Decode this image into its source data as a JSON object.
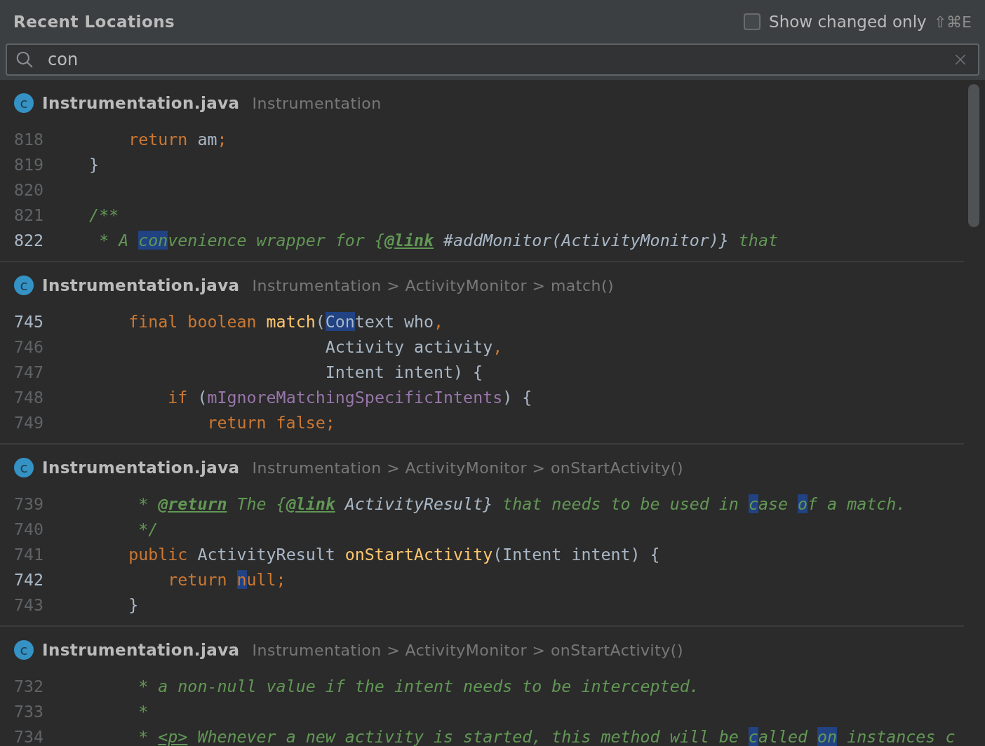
{
  "title": "Recent Locations",
  "show_changed_only": {
    "label": "Show changed only",
    "checked": false,
    "shortcut": "⇧⌘E"
  },
  "search": {
    "value": "con"
  },
  "sections": [
    {
      "icon_letter": "c",
      "file": "Instrumentation.java",
      "path": "Instrumentation",
      "lines": [
        {
          "number": "818",
          "current": false,
          "tokens": [
            {
              "kind": "keyword",
              "text": "        return",
              "match": false
            },
            {
              "kind": "plain",
              "text": " am",
              "match": false
            },
            {
              "kind": "keyword",
              "text": ";",
              "match": false
            }
          ]
        },
        {
          "number": "819",
          "current": false,
          "tokens": [
            {
              "kind": "plain",
              "text": "    }",
              "match": false
            }
          ]
        },
        {
          "number": "820",
          "current": false
        },
        {
          "number": "821",
          "current": false,
          "tokens": [
            {
              "kind": "comment",
              "text": "    /**",
              "match": false
            }
          ]
        },
        {
          "number": "822",
          "current": true,
          "tokens": [
            {
              "kind": "comment",
              "text": "     * A ",
              "match": false
            },
            {
              "kind": "comment",
              "text": "con",
              "match": true
            },
            {
              "kind": "comment",
              "text": "venience wrapper for {",
              "match": false
            },
            {
              "kind": "doc-tag",
              "text": "@link",
              "match": false
            },
            {
              "kind": "doc-ref",
              "text": " #addMonitor(ActivityMonitor)}",
              "match": false
            },
            {
              "kind": "comment",
              "text": " that",
              "match": false
            }
          ]
        }
      ]
    },
    {
      "icon_letter": "c",
      "file": "Instrumentation.java",
      "path": "Instrumentation > ActivityMonitor > match()",
      "lines": [
        {
          "number": "745",
          "current": true,
          "tokens": [
            {
              "kind": "keyword",
              "text": "        final boolean ",
              "match": false
            },
            {
              "kind": "function",
              "text": "match",
              "match": false
            },
            {
              "kind": "plain",
              "text": "(",
              "match": false
            },
            {
              "kind": "plain",
              "text": "Con",
              "match": true
            },
            {
              "kind": "plain",
              "text": "text who",
              "match": false
            },
            {
              "kind": "keyword",
              "text": ",",
              "match": false
            }
          ]
        },
        {
          "number": "746",
          "current": false,
          "tokens": [
            {
              "kind": "plain",
              "text": "                            Activity activity",
              "match": false
            },
            {
              "kind": "keyword",
              "text": ",",
              "match": false
            }
          ]
        },
        {
          "number": "747",
          "current": false,
          "tokens": [
            {
              "kind": "plain",
              "text": "                            Intent intent) {",
              "match": false
            }
          ]
        },
        {
          "number": "748",
          "current": false,
          "tokens": [
            {
              "kind": "keyword",
              "text": "            if",
              "match": false
            },
            {
              "kind": "plain",
              "text": " (",
              "match": false
            },
            {
              "kind": "field",
              "text": "mIgnoreMatchingSpecificIntents",
              "match": false
            },
            {
              "kind": "plain",
              "text": ") {",
              "match": false
            }
          ]
        },
        {
          "number": "749",
          "current": false,
          "tokens": [
            {
              "kind": "keyword",
              "text": "                return false;",
              "match": false
            }
          ]
        }
      ]
    },
    {
      "icon_letter": "c",
      "file": "Instrumentation.java",
      "path": "Instrumentation > ActivityMonitor > onStartActivity()",
      "lines": [
        {
          "number": "739",
          "current": false,
          "tokens": [
            {
              "kind": "comment",
              "text": "         * ",
              "match": false
            },
            {
              "kind": "doc-tag",
              "text": "@return",
              "match": false
            },
            {
              "kind": "comment",
              "text": " The {",
              "match": false
            },
            {
              "kind": "doc-tag",
              "text": "@link",
              "match": false
            },
            {
              "kind": "doc-ref",
              "text": " ActivityResult}",
              "match": false
            },
            {
              "kind": "comment",
              "text": " that needs to be used in ",
              "match": false
            },
            {
              "kind": "comment",
              "text": "c",
              "match": true
            },
            {
              "kind": "comment",
              "text": "ase ",
              "match": false
            },
            {
              "kind": "comment",
              "text": "o",
              "match": true
            },
            {
              "kind": "comment",
              "text": "f a match.",
              "match": false
            }
          ]
        },
        {
          "number": "740",
          "current": false,
          "tokens": [
            {
              "kind": "comment",
              "text": "         */",
              "match": false
            }
          ]
        },
        {
          "number": "741",
          "current": false,
          "tokens": [
            {
              "kind": "keyword",
              "text": "        public",
              "match": false
            },
            {
              "kind": "plain",
              "text": " ActivityResult ",
              "match": false
            },
            {
              "kind": "function",
              "text": "onStartActivity",
              "match": false
            },
            {
              "kind": "plain",
              "text": "(Intent intent) {",
              "match": false
            }
          ]
        },
        {
          "number": "742",
          "current": true,
          "tokens": [
            {
              "kind": "keyword",
              "text": "            return ",
              "match": false
            },
            {
              "kind": "keyword",
              "text": "n",
              "match": true
            },
            {
              "kind": "keyword",
              "text": "ull;",
              "match": false
            }
          ]
        },
        {
          "number": "743",
          "current": false,
          "tokens": [
            {
              "kind": "plain",
              "text": "        }",
              "match": false
            }
          ]
        }
      ]
    },
    {
      "icon_letter": "c",
      "file": "Instrumentation.java",
      "path": "Instrumentation > ActivityMonitor > onStartActivity()",
      "lines": [
        {
          "number": "732",
          "current": false,
          "tokens": [
            {
              "kind": "comment",
              "text": "         * a non-null value if the intent needs to be intercepted.",
              "match": false
            }
          ]
        },
        {
          "number": "733",
          "current": false,
          "tokens": [
            {
              "kind": "comment",
              "text": "         *",
              "match": false
            }
          ]
        },
        {
          "number": "734",
          "current": false,
          "tokens": [
            {
              "kind": "comment",
              "text": "         * ",
              "match": false
            },
            {
              "kind": "html-tag",
              "text": "<p>",
              "match": false
            },
            {
              "kind": "comment",
              "text": " Whenever a new activity is started, this method will be ",
              "match": false
            },
            {
              "kind": "comment",
              "text": "c",
              "match": true
            },
            {
              "kind": "comment",
              "text": "alled ",
              "match": false
            },
            {
              "kind": "comment",
              "text": "on",
              "match": true
            },
            {
              "kind": "comment",
              "text": " instances c",
              "match": false
            }
          ]
        }
      ]
    }
  ]
}
